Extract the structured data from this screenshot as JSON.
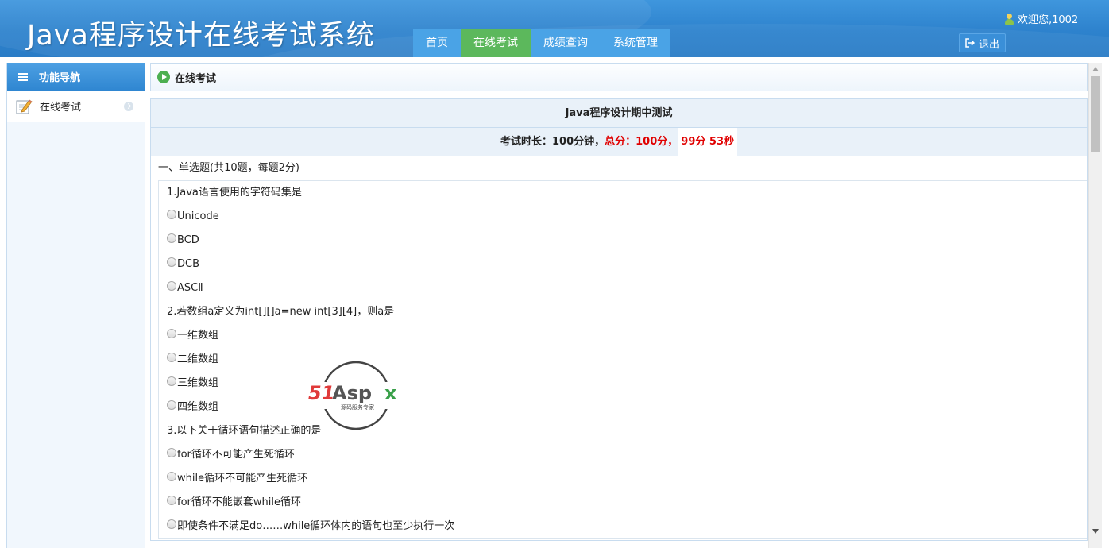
{
  "header": {
    "title": "Java程序设计在线考试系统",
    "nav": [
      {
        "label": "首页",
        "active": false
      },
      {
        "label": "在线考试",
        "active": true
      },
      {
        "label": "成绩查询",
        "active": false
      },
      {
        "label": "系统管理",
        "active": false
      }
    ],
    "user_greeting": "欢迎您,1002",
    "logout_label": "退出"
  },
  "sidebar": {
    "header": "功能导航",
    "items": [
      {
        "label": "在线考试",
        "icon": "pencil-icon"
      }
    ]
  },
  "breadcrumb": {
    "label": "在线考试"
  },
  "exam": {
    "title": "Java程序设计期中测试",
    "duration_label": "考试时长：100分钟，",
    "total_label": "总分：100分，",
    "remaining": "99分 53秒",
    "section_title": "一、单选题(共10题，每题2分)",
    "questions": [
      {
        "text": "1.Java语言使用的字符码集是",
        "options": [
          "Unicode",
          "BCD",
          "DCB",
          "ASCⅡ"
        ]
      },
      {
        "text": "2.若数组a定义为int[][]a=new int[3][4]，则a是",
        "options": [
          "一维数组",
          "二维数组",
          "三维数组",
          "四维数组"
        ]
      },
      {
        "text": "3.以下关于循环语句描述正确的是",
        "options": [
          "for循环不可能产生死循环",
          "while循环不可能产生死循环",
          "for循环不能嵌套while循环",
          "即使条件不满足do……while循环体内的语句也至少执行一次"
        ]
      }
    ]
  },
  "watermark": {
    "brand": "51Aspx",
    "tagline": "源码服务专家"
  },
  "colors": {
    "header_blue": "#2d82cd",
    "nav_tab": "#4aa3e6",
    "nav_active": "#5cb85c",
    "accent_red": "#e00000"
  }
}
